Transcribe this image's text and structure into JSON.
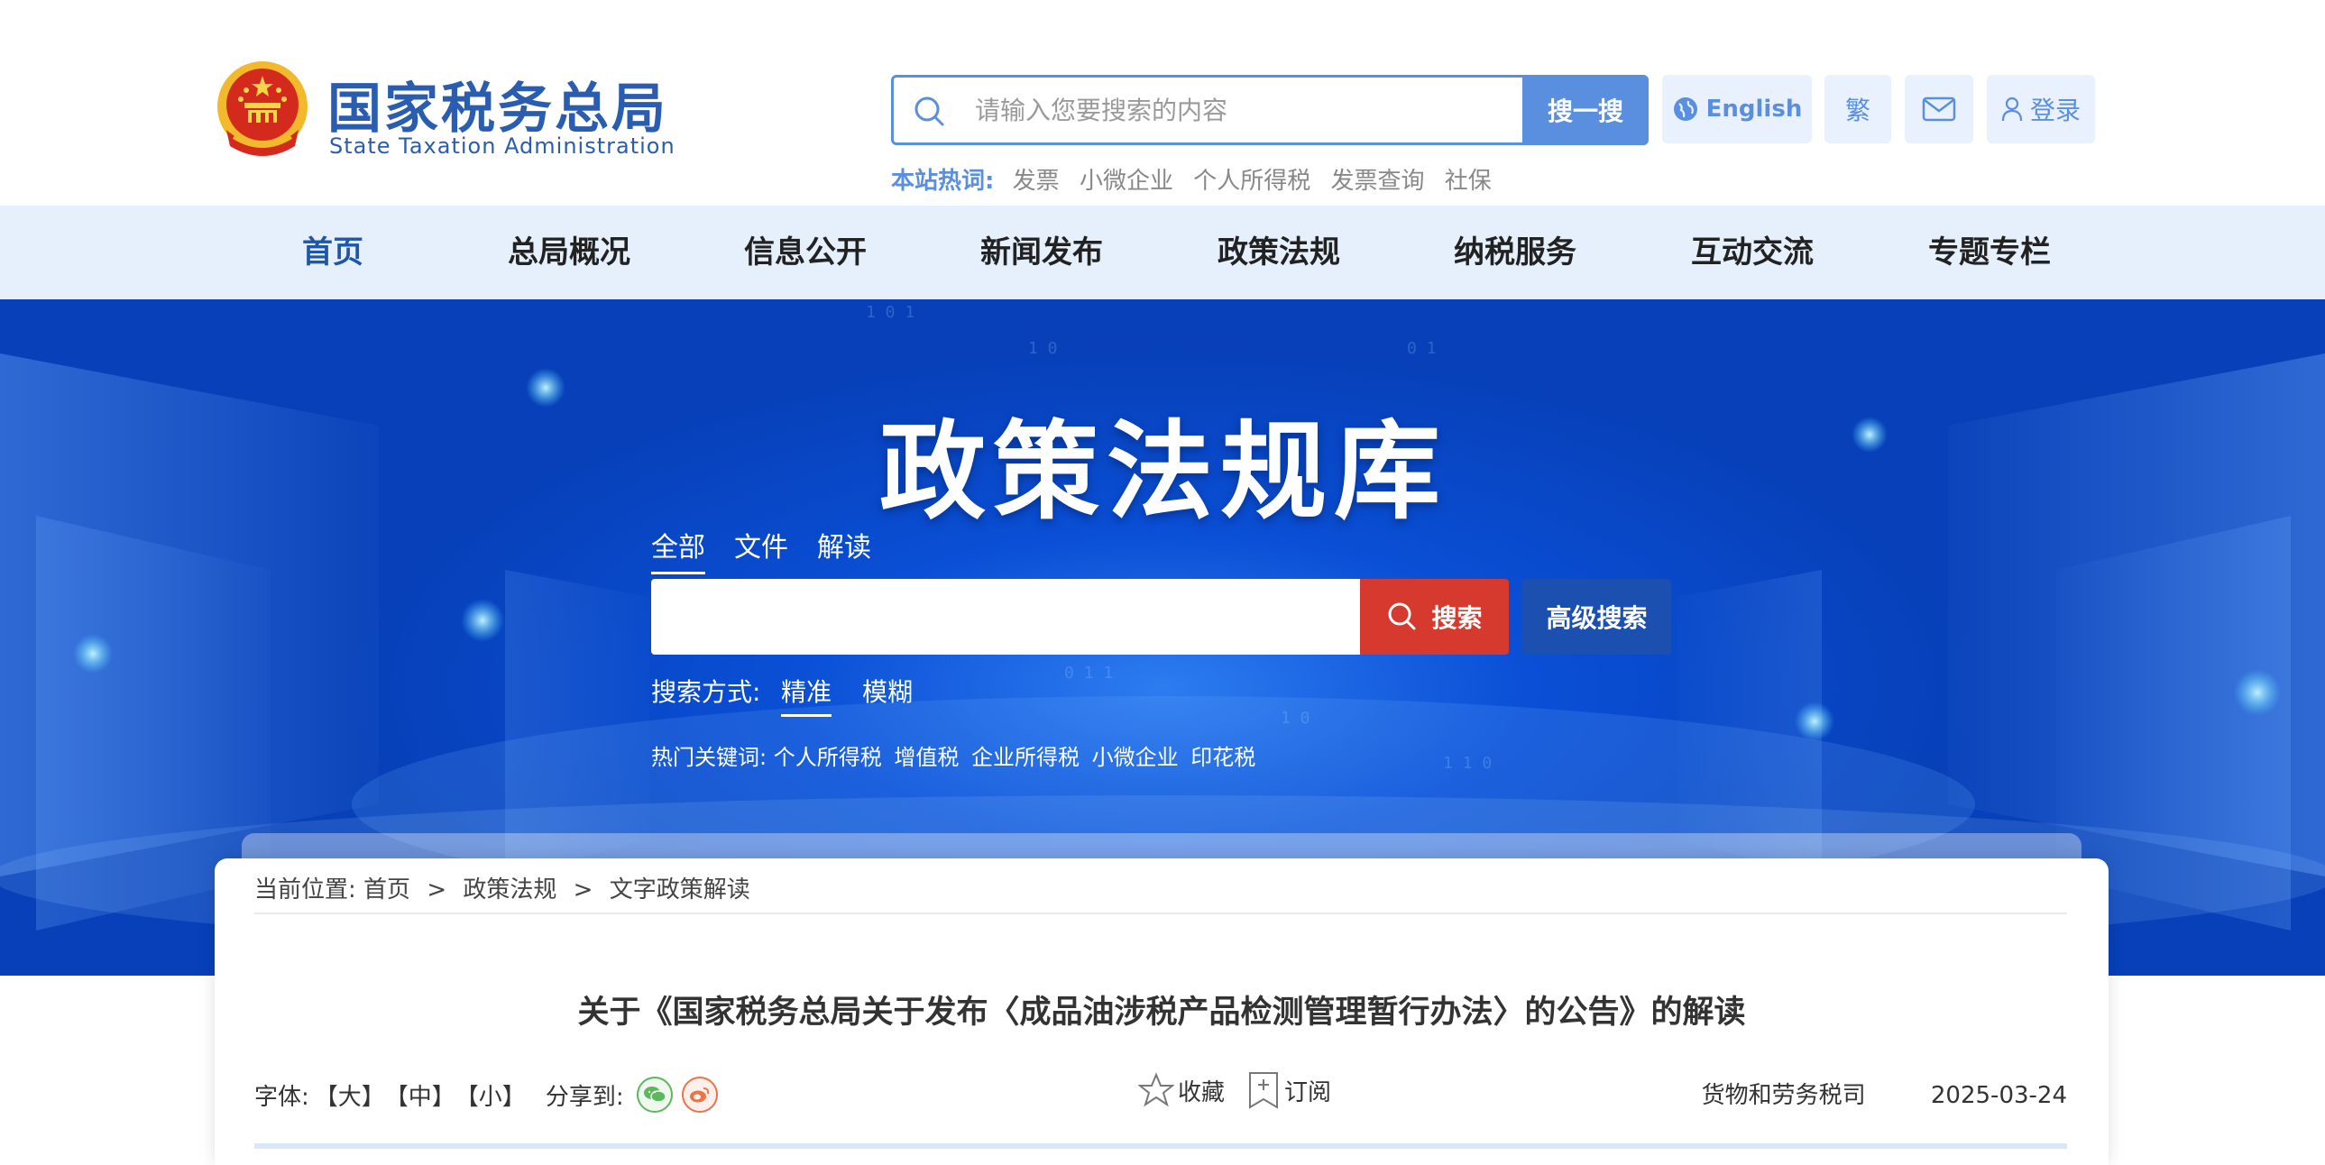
{
  "header": {
    "logo_cn": "国家税务总局",
    "logo_en": "State Taxation Administration",
    "search": {
      "placeholder": "请输入您要搜索的内容",
      "button": "搜一搜"
    },
    "english_label": "English",
    "traditional_label": "繁",
    "login_label": "登录",
    "hotwords_label": "本站热词:",
    "hotwords": [
      "发票",
      "小微企业",
      "个人所得税",
      "发票查询",
      "社保"
    ]
  },
  "nav": {
    "items": [
      {
        "label": "首页",
        "active": true
      },
      {
        "label": "总局概况"
      },
      {
        "label": "信息公开"
      },
      {
        "label": "新闻发布"
      },
      {
        "label": "政策法规"
      },
      {
        "label": "纳税服务"
      },
      {
        "label": "互动交流"
      },
      {
        "label": "专题专栏"
      }
    ]
  },
  "banner": {
    "title": "政策法规库",
    "tabs": [
      {
        "label": "全部",
        "active": true
      },
      {
        "label": "文件"
      },
      {
        "label": "解读"
      }
    ],
    "search_button": "搜索",
    "advanced_button": "高级搜索",
    "mode_label": "搜索方式:",
    "modes": [
      {
        "label": "精准",
        "active": true
      },
      {
        "label": "模糊"
      }
    ],
    "keywords_label": "热门关键词:",
    "keywords": [
      "个人所得税",
      "增值税",
      "企业所得税",
      "小微企业",
      "印花税"
    ]
  },
  "breadcrumb": {
    "label": "当前位置:",
    "items": [
      "首页",
      "政策法规",
      "文字政策解读"
    ],
    "separator": ">"
  },
  "article": {
    "title": "关于《国家税务总局关于发布〈成品油涉税产品检测管理暂行办法〉的公告》的解读",
    "font_label": "字体:",
    "font_sizes": [
      "【大】",
      "【中】",
      "【小】"
    ],
    "share_label": "分享到:",
    "favorite_label": "收藏",
    "subscribe_label": "订阅",
    "department": "货物和劳务税司",
    "date": "2025-03-24"
  },
  "colors": {
    "brand_blue": "#2a5db0",
    "accent_blue": "#5a8fe0",
    "nav_bg": "#e6f0fc",
    "search_red": "#d63a2e",
    "advanced_blue": "#1b4fb0"
  }
}
